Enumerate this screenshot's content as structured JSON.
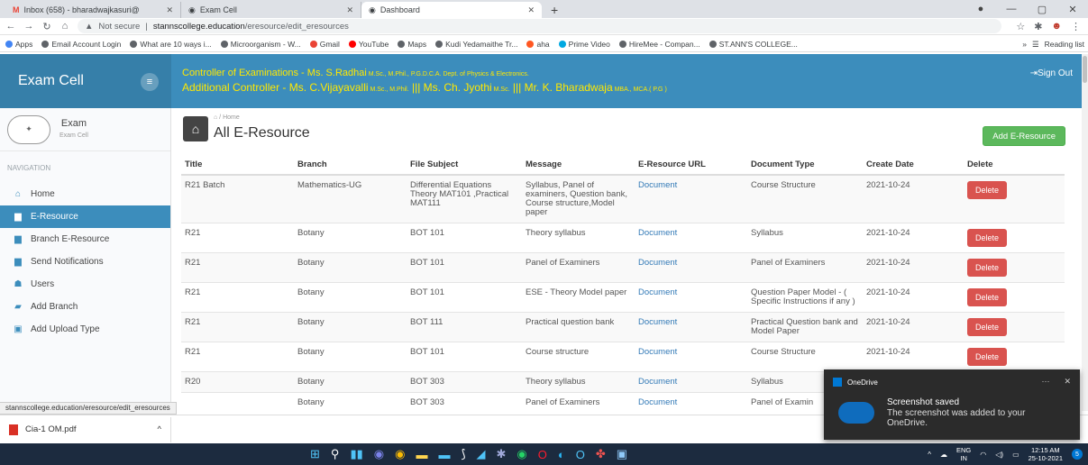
{
  "browser": {
    "tabs": [
      {
        "title": "Inbox (658) - bharadwajkasuri@",
        "icon_color": "#ea4335"
      },
      {
        "title": "Exam Cell",
        "icon_color": "#5f6368"
      },
      {
        "title": "Dashboard",
        "icon_color": "#5f6368"
      }
    ],
    "new_tab": "+",
    "address": {
      "security": "Not secure",
      "host": "stannscollege.education",
      "path": "/eresource/edit_eresources"
    },
    "bookmarks": [
      "Apps",
      "Email Account Login",
      "What are 10 ways i...",
      "Microorganism - W...",
      "Gmail",
      "YouTube",
      "Maps",
      "Kudi Yedamaithe Tr...",
      "aha",
      "Prime Video",
      "HireMee - Compan...",
      "ST.ANN'S COLLEGE..."
    ],
    "reading_list": "Reading list",
    "more_bookmarks": "»",
    "status_url": "stannscollege.education/eresource/edit_eresources"
  },
  "app": {
    "brand": "Exam Cell",
    "header": {
      "line1_main": "Controller of Examinations - Ms. S.Radhai",
      "line1_quals": " M.Sc., M.Phil., P.G.D.C.A. Dept. of Physics & Electronics.",
      "line2_a": "Additional Controller - Ms. C.Vijayavalli",
      "line2_a_quals": " M.Sc., M.Phil.",
      "line2_b": " ||| Ms. Ch. Jyothi",
      "line2_b_quals": " M.Sc.",
      "line2_c": " ||| Mr. K. Bharadwaja",
      "line2_c_quals": " MBA., MCA.( P.G )",
      "signout": "Sign Out"
    },
    "user": {
      "name": "Exam",
      "role": "Exam Cell",
      "logo_text": "logo"
    },
    "nav_header": "NAVIGATION",
    "nav": [
      {
        "label": "Home",
        "icon": "home-icon",
        "glyph": "⌂",
        "active": false
      },
      {
        "label": "E-Resource",
        "icon": "folder-icon",
        "glyph": "▆",
        "active": true
      },
      {
        "label": "Branch E-Resource",
        "icon": "folder-icon",
        "glyph": "▆",
        "active": false
      },
      {
        "label": "Send Notifications",
        "icon": "folder-icon",
        "glyph": "▆",
        "active": false
      },
      {
        "label": "Users",
        "icon": "user-icon",
        "glyph": "☗",
        "active": false
      },
      {
        "label": "Add Branch",
        "icon": "card-icon",
        "glyph": "▰",
        "active": false
      },
      {
        "label": "Add Upload Type",
        "icon": "file-icon",
        "glyph": "▣",
        "active": false
      }
    ],
    "page": {
      "breadcrumb": "Home",
      "title": "All E-Resource",
      "add_button": "Add E-Resource"
    },
    "table": {
      "headers": [
        "Title",
        "Branch",
        "File Subject",
        "Message",
        "E-Resource URL",
        "Document Type",
        "Create Date",
        "Delete"
      ],
      "rows": [
        [
          "R21 Batch",
          "Mathematics-UG",
          "Differential Equations Theory MAT101 ,Practical MAT111",
          "Syllabus, Panel of examiners, Question bank, Course structure,Model paper",
          "Document",
          "Course Structure",
          "2021-10-24",
          "Delete"
        ],
        [
          "R21",
          "Botany",
          "BOT 101",
          "Theory syllabus",
          "Document",
          "Syllabus",
          "2021-10-24",
          "Delete"
        ],
        [
          "R21",
          "Botany",
          "BOT 101",
          "Panel of Examiners",
          "Document",
          "Panel of Examiners",
          "2021-10-24",
          "Delete"
        ],
        [
          "R21",
          "Botany",
          "BOT 101",
          "ESE - Theory Model paper",
          "Document",
          "Question Paper Model - ( Specific Instructions if any )",
          "2021-10-24",
          "Delete"
        ],
        [
          "R21",
          "Botany",
          "BOT 111",
          "Practical question bank",
          "Document",
          "Practical Question bank and Model Paper",
          "2021-10-24",
          "Delete"
        ],
        [
          "R21",
          "Botany",
          "BOT 101",
          "Course structure",
          "Document",
          "Course Structure",
          "2021-10-24",
          "Delete"
        ],
        [
          "R20",
          "Botany",
          "BOT 303",
          "Theory syllabus",
          "Document",
          "Syllabus",
          "",
          ""
        ],
        [
          "",
          "Botany",
          "BOT 303",
          "Panel of Examiners",
          "Document",
          "Panel of Examin",
          "",
          ""
        ]
      ]
    }
  },
  "downloads": {
    "file": "Cia-1 OM.pdf",
    "chevron": "^"
  },
  "toast": {
    "app": "OneDrive",
    "more": "···",
    "close": "✕",
    "title": "Screenshot saved",
    "body": "The screenshot was added to your OneDrive."
  },
  "taskbar": {
    "lang": "ENG",
    "region": "IN",
    "time": "12:15 AM",
    "date": "25-10-2021",
    "notif_count": "5"
  },
  "colors": {
    "brand": "#367fa9",
    "header": "#3c8dbc",
    "header_text": "#ffe800",
    "success": "#5cb85c",
    "danger": "#d9534f",
    "link": "#337ab7"
  }
}
